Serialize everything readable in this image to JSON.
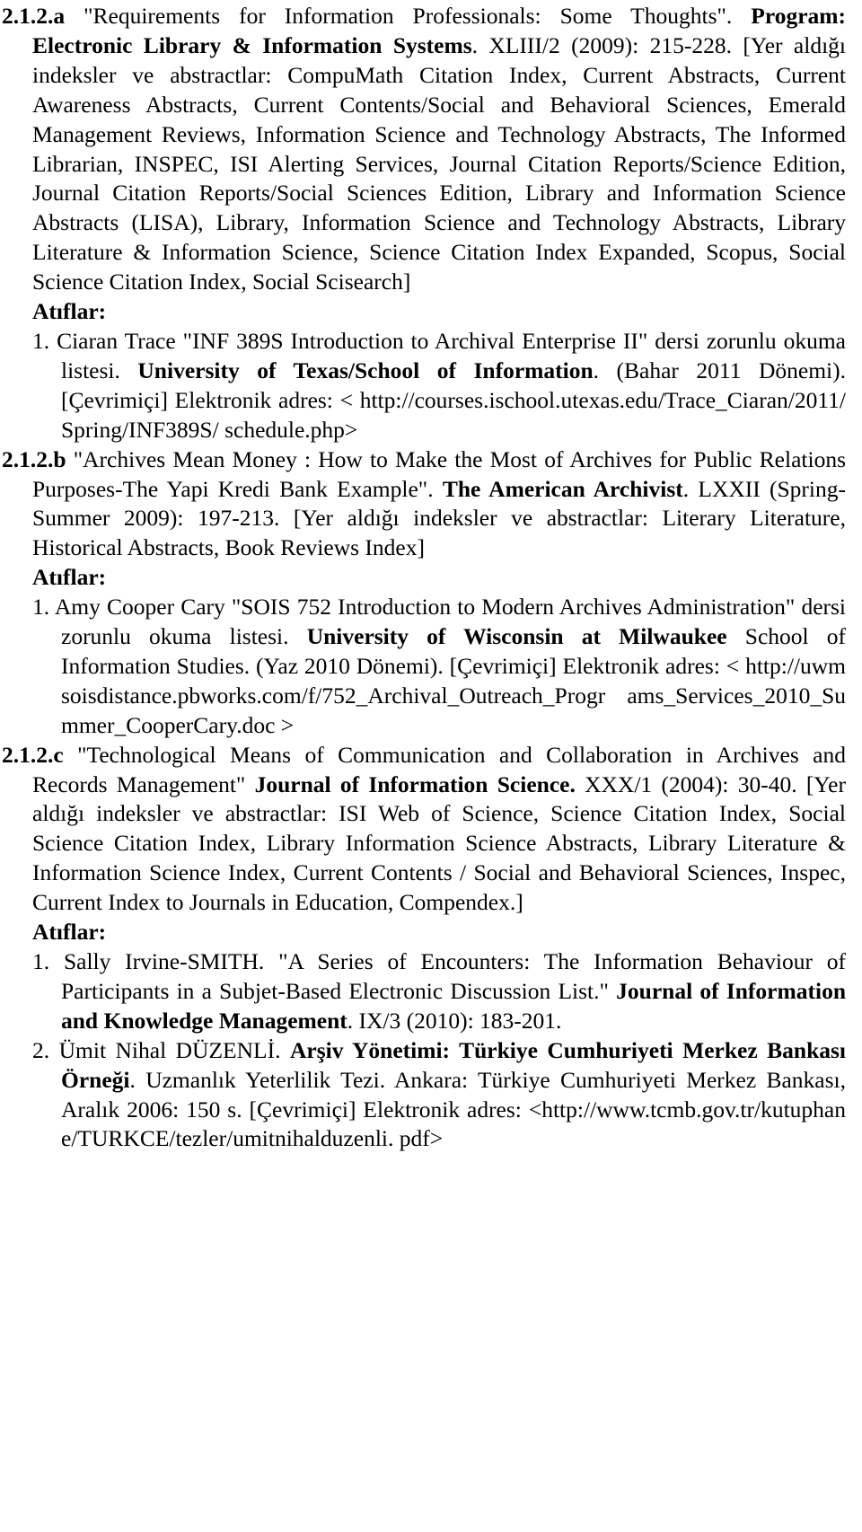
{
  "entries": [
    {
      "code": "2.1.2.a",
      "title": "\"Requirements for Information Professionals: Some Thoughts\".",
      "journal": "Program: Electronic Library & Information Systems",
      "details": ". XLIII/2 (2009): 215-228. [Yer aldığı indeksler ve abstractlar: CompuMath Citation Index, Current Abstracts, Current Awareness Abstracts, Current Contents/Social and Behavioral Sciences, Emerald Management Reviews, Information Science and Technology Abstracts, The Informed Librarian, INSPEC, ISI Alerting Services, Journal Citation Reports/Science Edition, Journal Citation Reports/Social Sciences Edition, Library and Information Science Abstracts (LISA), Library, Information Science and Technology Abstracts, Library Literature & Information Science, Science Citation Index Expanded, Scopus, Social Science Citation Index, Social Scisearch]",
      "citations_heading": "Atıflar:",
      "citations": [
        {
          "num": "1.",
          "pre": "Ciaran Trace \"INF 389S Introduction to Archival Enterprise II\" dersi zorunlu okuma listesi.",
          "bold": "University of Texas/School of Information",
          "post": ". (Bahar 2011 Dönemi). [Çevrimiçi] Elektronik adres: <",
          "url": "http://courses.ischool.utexas.edu/Trace_Ciaran/2011/Spring/INF389S/ schedule.php>"
        }
      ]
    },
    {
      "code": "2.1.2.b",
      "title": "\"Archives Mean Money : How to Make the Most of Archives for Public Relations Purposes-The Yapi Kredi Bank Example\".",
      "journal": "The American Archivist",
      "details": ". LXXII (Spring-Summer 2009): 197-213. [Yer aldığı indeksler ve abstractlar: Literary Literature, Historical Abstracts, Book Reviews Index]",
      "citations_heading": "Atıflar:",
      "citations": [
        {
          "num": "1.",
          "pre": "Amy Cooper Cary \"SOIS 752 Introduction to Modern Archives Administration\" dersi zorunlu okuma listesi.",
          "bold": "University of Wisconsin at Milwaukee",
          "post": " School of Information Studies. (Yaz 2010 Dönemi). [Çevrimiçi] Elektronik adres: <",
          "url": "http://uwmsoisdistance.pbworks.com/f/752_Archival_Outreach_Progr ams_Services_2010_Summer_CooperCary.doc >"
        }
      ]
    },
    {
      "code": "2.1.2.c",
      "title": "\"Technological Means of Communication and Collaboration in Archives and Records Management\"",
      "journal": "Journal of Information Science.",
      "details": " XXX/1 (2004): 30-40. [Yer aldığı indeksler ve abstractlar: ISI Web of Science, Science Citation Index, Social Science Citation Index, Library Information Science Abstracts, Library Literature & Information Science Index, Current Contents / Social and Behavioral Sciences, Inspec, Current Index to Journals in Education, Compendex.]",
      "citations_heading": "Atıflar:",
      "citations": [
        {
          "num": "1.",
          "pre": "Sally Irvine-SMITH. \"A Series of Encounters: The Information Behaviour of Participants in a Subjet-Based Electronic Discussion List.\"",
          "bold": "Journal of Information and Knowledge Management",
          "post": ". IX/3 (2010): 183-201.",
          "url": ""
        },
        {
          "num": "2.",
          "pre": "Ümit Nihal DÜZENLİ.",
          "bold": "Arşiv Yönetimi: Türkiye Cumhuriyeti Merkez Bankası Örneği",
          "post": ". Uzmanlık Yeterlilik Tezi. Ankara: Türkiye Cumhuriyeti Merkez Bankası, Aralık 2006: 150 s. [Çevrimiçi] Elektronik adres:",
          "url": "<http://www.tcmb.gov.tr/kutuphane/TURKCE/tezler/umitnihalduzenli. pdf>"
        }
      ]
    }
  ]
}
